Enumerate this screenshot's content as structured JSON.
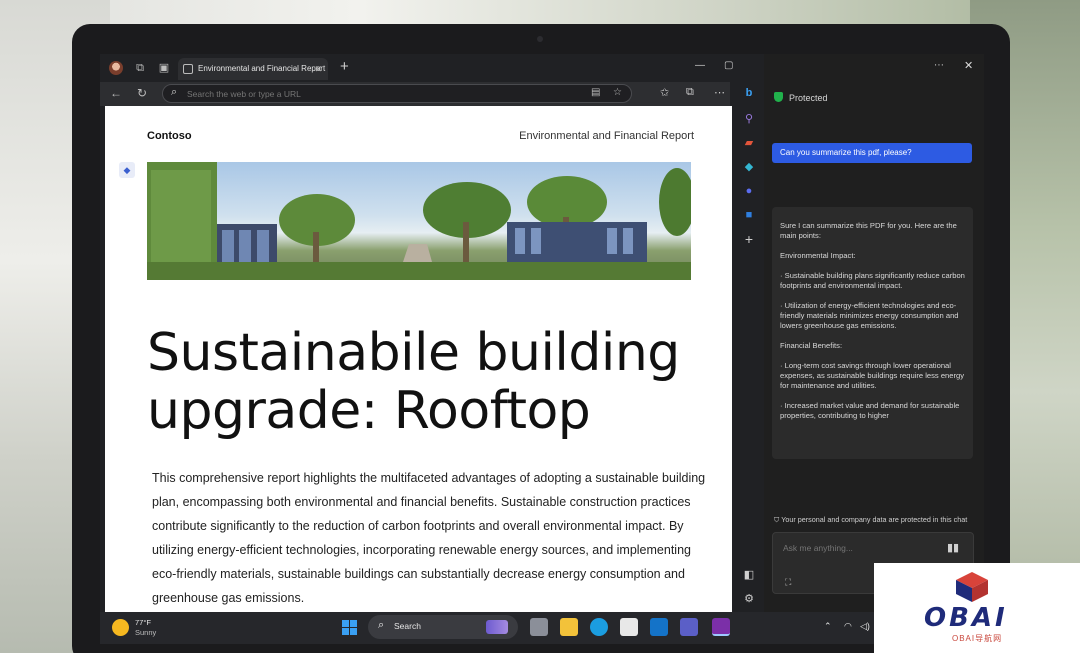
{
  "browser": {
    "tab_title": "Environmental and Financial Report",
    "address_placeholder": "Search the web or type a URL"
  },
  "pdf": {
    "brand": "Contoso",
    "header": "Environmental and Financial Report",
    "title_line1": "Sustainabile building",
    "title_line2": "upgrade: Rooftop",
    "body": "This comprehensive report highlights the multifaceted advantages of adopting a sustainable building plan, encompassing both environmental and financial benefits. Sustainable construction practices contribute significantly to the reduction of carbon footprints and overall environmental impact. By utilizing energy-efficient technologies, incorporating renewable energy sources, and implementing eco-friendly materials, sustainable buildings can substantially decrease energy consumption and greenhouse gas emissions."
  },
  "copilot": {
    "protected_label": "Protected",
    "user_message": "Can you summarize this pdf, please?",
    "bot_intro": "Sure I can summarize this PDF for you. Here are the main points:",
    "section1_title": "Environmental Impact:",
    "section1_point1": "· Sustainable building plans significantly reduce carbon footprints and environmental impact.",
    "section1_point2": "· Utilization of energy-efficient technologies and eco-friendly materials minimizes energy consumption and lowers greenhouse gas emissions.",
    "section2_title": "Financial Benefits:",
    "section2_point1": "· Long-term cost savings through lower operational expenses, as sustainable buildings require less energy for maintenance and utilities.",
    "section2_point2": "· Increased market value and demand for sustainable properties, contributing to higher",
    "privacy_note": "Your personal and company data are protected in this chat",
    "ask_placeholder": "Ask me anything..."
  },
  "taskbar": {
    "temperature": "77°F",
    "condition": "Sunny",
    "search_label": "Search"
  },
  "watermark": {
    "brand": "OBAI",
    "subtitle": "OBAI导航网"
  },
  "colors": {
    "accent_blue": "#2d5be3",
    "shield_green": "#21b14c",
    "panel_bg": "#1f1f1f",
    "taskbar_bg": "#26272b"
  }
}
